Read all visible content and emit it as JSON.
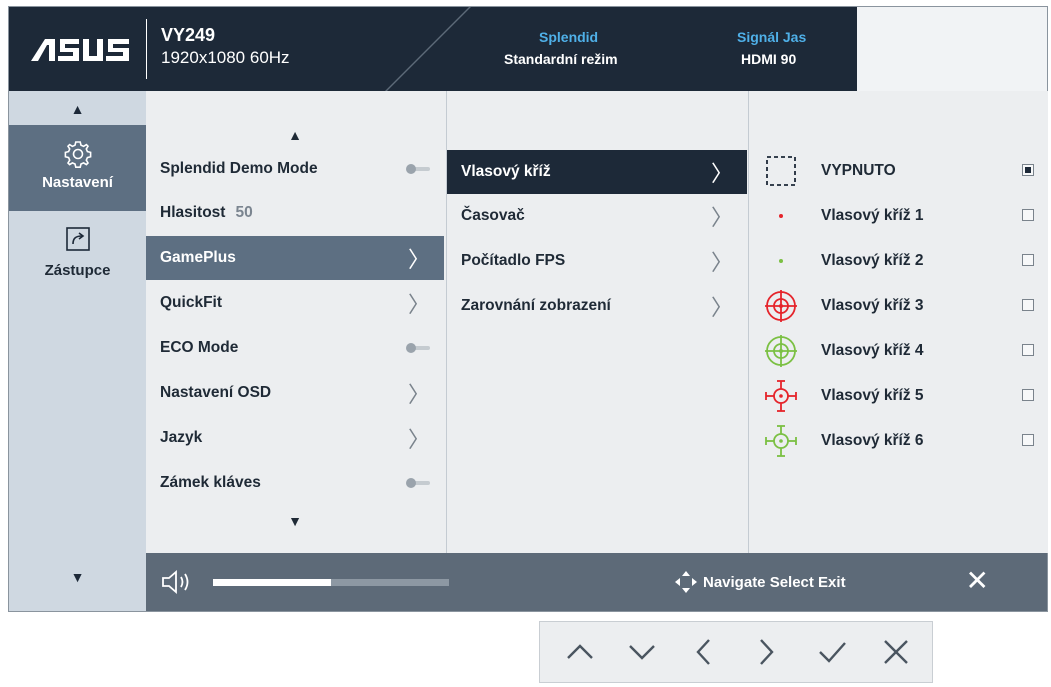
{
  "header": {
    "logo_text": "ASUS",
    "model": "VY249",
    "resolution": "1920x1080 60Hz",
    "splendid_label": "Splendid",
    "splendid_value": "Standardní režim",
    "signal_label": "Signál Jas",
    "signal_value": "HDMI 90"
  },
  "sidebar": {
    "items": [
      {
        "label": "Nastavení",
        "icon": "gear-icon",
        "active": true
      },
      {
        "label": "Zástupce",
        "icon": "shortcut-icon",
        "active": false
      }
    ]
  },
  "menu": {
    "items": [
      {
        "label": "Splendid Demo Mode",
        "control": "toggle"
      },
      {
        "label": "Hlasitost",
        "value": "50"
      },
      {
        "label": "GamePlus",
        "control": "chevron",
        "highlighted": true
      },
      {
        "label": "QuickFit",
        "control": "chevron"
      },
      {
        "label": "ECO Mode",
        "control": "toggle"
      },
      {
        "label": "Nastavení OSD",
        "control": "chevron"
      },
      {
        "label": "Jazyk",
        "control": "chevron"
      },
      {
        "label": "Zámek kláves",
        "control": "toggle"
      }
    ]
  },
  "submenu": {
    "items": [
      {
        "label": "Vlasový kříž",
        "selected": true
      },
      {
        "label": "Časovač"
      },
      {
        "label": "Počítadlo FPS"
      },
      {
        "label": "Zarovnání zobrazení"
      }
    ]
  },
  "crosshair": {
    "options": [
      {
        "label": "VYPNUTO",
        "icon": "dashed-square-icon",
        "checked": true
      },
      {
        "label": "Vlasový kříž 1",
        "icon": "red-dot-icon",
        "checked": false
      },
      {
        "label": "Vlasový kříž 2",
        "icon": "green-dot-icon",
        "checked": false
      },
      {
        "label": "Vlasový kříž 3",
        "icon": "red-target-icon",
        "checked": false
      },
      {
        "label": "Vlasový kříž 4",
        "icon": "green-target-icon",
        "checked": false
      },
      {
        "label": "Vlasový kříž 5",
        "icon": "red-reticle-icon",
        "checked": false
      },
      {
        "label": "Vlasový kříž 6",
        "icon": "green-reticle-icon",
        "checked": false
      }
    ]
  },
  "bottom_bar": {
    "volume_fraction": 0.5,
    "hint": "Navigate Select Exit"
  },
  "colors": {
    "header_dark": "#1d2938",
    "accent_blue": "#4fb0e8",
    "highlight": "#5d6f82",
    "crosshair_red": "#e5242b",
    "crosshair_green": "#7bc043"
  },
  "hardware_keys": [
    "chevron-up-icon",
    "chevron-down-icon",
    "chevron-left-icon",
    "chevron-right-icon",
    "check-icon",
    "close-icon"
  ]
}
